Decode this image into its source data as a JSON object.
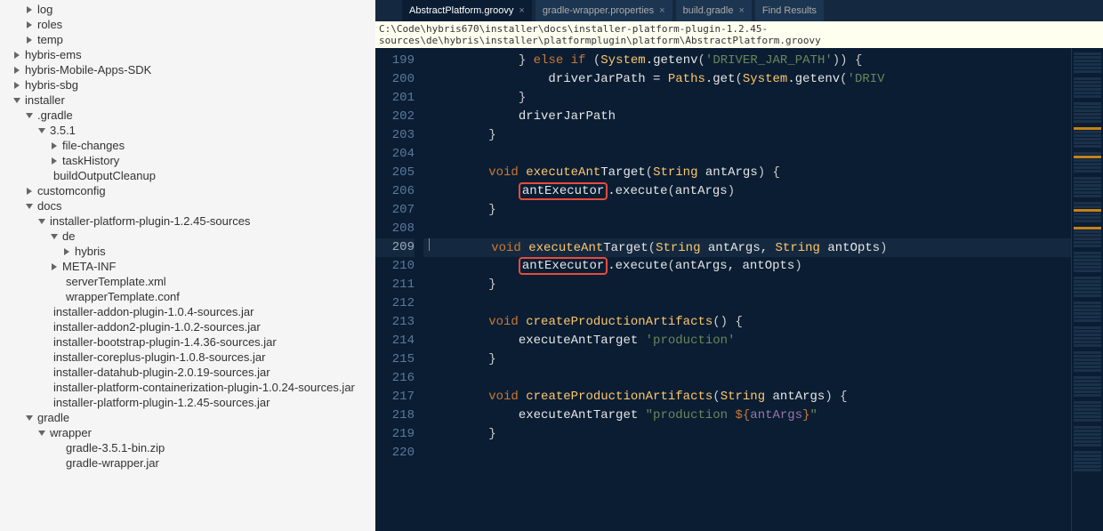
{
  "sidebar": {
    "items": [
      {
        "label": "log",
        "icon": "tri-right",
        "indent": 0
      },
      {
        "label": "roles",
        "icon": "tri-right",
        "indent": 0
      },
      {
        "label": "temp",
        "icon": "tri-right",
        "indent": 0
      },
      {
        "label": "hybris-ems",
        "icon": "tri-right",
        "indent": -1
      },
      {
        "label": "hybris-Mobile-Apps-SDK",
        "icon": "tri-right",
        "indent": -1
      },
      {
        "label": "hybris-sbg",
        "icon": "tri-right",
        "indent": -1
      },
      {
        "label": "installer",
        "icon": "tri-down",
        "indent": -1
      },
      {
        "label": ".gradle",
        "icon": "tri-down",
        "indent": 0
      },
      {
        "label": "3.5.1",
        "icon": "tri-down",
        "indent": 1
      },
      {
        "label": "file-changes",
        "icon": "tri-right",
        "indent": 2
      },
      {
        "label": "taskHistory",
        "icon": "tri-right",
        "indent": 2
      },
      {
        "label": "buildOutputCleanup",
        "icon": "leaf",
        "indent": 1
      },
      {
        "label": "customconfig",
        "icon": "tri-right",
        "indent": 0
      },
      {
        "label": "docs",
        "icon": "tri-down",
        "indent": 0
      },
      {
        "label": "installer-platform-plugin-1.2.45-sources",
        "icon": "tri-down",
        "indent": 1
      },
      {
        "label": "de",
        "icon": "tri-down",
        "indent": 2
      },
      {
        "label": "hybris",
        "icon": "tri-right",
        "indent": 3
      },
      {
        "label": "META-INF",
        "icon": "tri-right",
        "indent": 2
      },
      {
        "label": "serverTemplate.xml",
        "icon": "leaf",
        "indent": 2
      },
      {
        "label": "wrapperTemplate.conf",
        "icon": "leaf",
        "indent": 2
      },
      {
        "label": "installer-addon-plugin-1.0.4-sources.jar",
        "icon": "leaf",
        "indent": 1
      },
      {
        "label": "installer-addon2-plugin-1.0.2-sources.jar",
        "icon": "leaf",
        "indent": 1
      },
      {
        "label": "installer-bootstrap-plugin-1.4.36-sources.jar",
        "icon": "leaf",
        "indent": 1
      },
      {
        "label": "installer-coreplus-plugin-1.0.8-sources.jar",
        "icon": "leaf",
        "indent": 1
      },
      {
        "label": "installer-datahub-plugin-2.0.19-sources.jar",
        "icon": "leaf",
        "indent": 1
      },
      {
        "label": "installer-platform-containerization-plugin-1.0.24-sources.jar",
        "icon": "leaf",
        "indent": 1
      },
      {
        "label": "installer-platform-plugin-1.2.45-sources.jar",
        "icon": "leaf",
        "indent": 1
      },
      {
        "label": "gradle",
        "icon": "tri-down",
        "indent": 0
      },
      {
        "label": "wrapper",
        "icon": "tri-down",
        "indent": 1
      },
      {
        "label": "gradle-3.5.1-bin.zip",
        "icon": "leaf",
        "indent": 2
      },
      {
        "label": "gradle-wrapper.jar",
        "icon": "leaf",
        "indent": 2
      }
    ]
  },
  "tabs": [
    {
      "label": "AbstractPlatform.groovy",
      "active": true
    },
    {
      "label": "gradle-wrapper.properties",
      "active": false
    },
    {
      "label": "build.gradle",
      "active": false
    },
    {
      "label": "Find Results",
      "active": false
    }
  ],
  "filepath": "C:\\Code\\hybris670\\installer\\docs\\installer-platform-plugin-1.2.45-sources\\de\\hybris\\installer\\platformplugin\\platform\\AbstractPlatform.groovy",
  "lineStart": 199,
  "currentLine": 209,
  "code": {
    "lines": [
      {
        "n": 199,
        "t": [
          {
            "c": "w",
            "v": "            "
          },
          {
            "c": "br",
            "v": "}"
          },
          {
            "c": "w",
            "v": " "
          },
          {
            "c": "kw",
            "v": "else if"
          },
          {
            "c": "w",
            "v": " "
          },
          {
            "c": "br",
            "v": "("
          },
          {
            "c": "ty",
            "v": "System"
          },
          {
            "c": "op",
            "v": "."
          },
          {
            "c": "wh",
            "v": "getenv"
          },
          {
            "c": "br",
            "v": "("
          },
          {
            "c": "st",
            "v": "'DRIVER_JAR_PATH'"
          },
          {
            "c": "br",
            "v": "))"
          },
          {
            "c": "w",
            "v": " "
          },
          {
            "c": "br",
            "v": "{"
          }
        ]
      },
      {
        "n": 200,
        "t": [
          {
            "c": "w",
            "v": "                "
          },
          {
            "c": "wh",
            "v": "driverJarPath"
          },
          {
            "c": "w",
            "v": " "
          },
          {
            "c": "op",
            "v": "="
          },
          {
            "c": "w",
            "v": " "
          },
          {
            "c": "ty",
            "v": "Paths"
          },
          {
            "c": "op",
            "v": "."
          },
          {
            "c": "wh",
            "v": "get"
          },
          {
            "c": "br",
            "v": "("
          },
          {
            "c": "ty",
            "v": "System"
          },
          {
            "c": "op",
            "v": "."
          },
          {
            "c": "wh",
            "v": "getenv"
          },
          {
            "c": "br",
            "v": "("
          },
          {
            "c": "st",
            "v": "'DRIV"
          }
        ]
      },
      {
        "n": 201,
        "t": [
          {
            "c": "w",
            "v": "            "
          },
          {
            "c": "br",
            "v": "}"
          }
        ]
      },
      {
        "n": 202,
        "t": [
          {
            "c": "w",
            "v": "            "
          },
          {
            "c": "wh",
            "v": "driverJarPath"
          }
        ]
      },
      {
        "n": 203,
        "t": [
          {
            "c": "w",
            "v": "        "
          },
          {
            "c": "br",
            "v": "}"
          }
        ]
      },
      {
        "n": 204,
        "t": []
      },
      {
        "n": 205,
        "t": [
          {
            "c": "w",
            "v": "        "
          },
          {
            "c": "kw",
            "v": "void"
          },
          {
            "c": "w",
            "v": " "
          },
          {
            "c": "fn",
            "v": "executeAnt"
          },
          {
            "c": "wh",
            "v": "Target"
          },
          {
            "c": "br",
            "v": "("
          },
          {
            "c": "ty",
            "v": "String"
          },
          {
            "c": "w",
            "v": " "
          },
          {
            "c": "wh",
            "v": "antArgs"
          },
          {
            "c": "br",
            "v": ")"
          },
          {
            "c": "w",
            "v": " "
          },
          {
            "c": "br",
            "v": "{"
          }
        ]
      },
      {
        "n": 206,
        "t": [
          {
            "c": "w",
            "v": "            "
          },
          {
            "c": "boxed",
            "v": "antExecutor"
          },
          {
            "c": "op",
            "v": "."
          },
          {
            "c": "wh",
            "v": "execute"
          },
          {
            "c": "br",
            "v": "("
          },
          {
            "c": "wh",
            "v": "antArgs"
          },
          {
            "c": "br",
            "v": ")"
          }
        ]
      },
      {
        "n": 207,
        "t": [
          {
            "c": "w",
            "v": "        "
          },
          {
            "c": "br",
            "v": "}"
          }
        ]
      },
      {
        "n": 208,
        "t": []
      },
      {
        "n": 209,
        "t": [
          {
            "c": "w",
            "v": "        "
          },
          {
            "c": "kw",
            "v": "void"
          },
          {
            "c": "w",
            "v": " "
          },
          {
            "c": "fn",
            "v": "executeAnt"
          },
          {
            "c": "wh",
            "v": "Target"
          },
          {
            "c": "br",
            "v": "("
          },
          {
            "c": "ty",
            "v": "String"
          },
          {
            "c": "w",
            "v": " "
          },
          {
            "c": "wh",
            "v": "antArgs"
          },
          {
            "c": "op",
            "v": ","
          },
          {
            "c": "w",
            "v": " "
          },
          {
            "c": "ty",
            "v": "String"
          },
          {
            "c": "w",
            "v": " "
          },
          {
            "c": "wh",
            "v": "antOpts"
          },
          {
            "c": "br",
            "v": ")"
          }
        ],
        "current": true
      },
      {
        "n": 210,
        "t": [
          {
            "c": "w",
            "v": "            "
          },
          {
            "c": "boxed",
            "v": "antExecutor"
          },
          {
            "c": "op",
            "v": "."
          },
          {
            "c": "wh",
            "v": "execute"
          },
          {
            "c": "br",
            "v": "("
          },
          {
            "c": "wh",
            "v": "antArgs"
          },
          {
            "c": "op",
            "v": ","
          },
          {
            "c": "w",
            "v": " "
          },
          {
            "c": "wh",
            "v": "antOpts"
          },
          {
            "c": "br",
            "v": ")"
          }
        ]
      },
      {
        "n": 211,
        "t": [
          {
            "c": "w",
            "v": "        "
          },
          {
            "c": "br",
            "v": "}"
          }
        ]
      },
      {
        "n": 212,
        "t": []
      },
      {
        "n": 213,
        "t": [
          {
            "c": "w",
            "v": "        "
          },
          {
            "c": "kw",
            "v": "void"
          },
          {
            "c": "w",
            "v": " "
          },
          {
            "c": "fn",
            "v": "createProductionArtifacts"
          },
          {
            "c": "br",
            "v": "()"
          },
          {
            "c": "w",
            "v": " "
          },
          {
            "c": "br",
            "v": "{"
          }
        ]
      },
      {
        "n": 214,
        "t": [
          {
            "c": "w",
            "v": "            "
          },
          {
            "c": "wh",
            "v": "executeAntTarget"
          },
          {
            "c": "w",
            "v": " "
          },
          {
            "c": "st",
            "v": "'production'"
          }
        ]
      },
      {
        "n": 215,
        "t": [
          {
            "c": "w",
            "v": "        "
          },
          {
            "c": "br",
            "v": "}"
          }
        ]
      },
      {
        "n": 216,
        "t": []
      },
      {
        "n": 217,
        "t": [
          {
            "c": "w",
            "v": "        "
          },
          {
            "c": "kw",
            "v": "void"
          },
          {
            "c": "w",
            "v": " "
          },
          {
            "c": "fn",
            "v": "createProductionArtifacts"
          },
          {
            "c": "br",
            "v": "("
          },
          {
            "c": "ty",
            "v": "String"
          },
          {
            "c": "w",
            "v": " "
          },
          {
            "c": "wh",
            "v": "antArgs"
          },
          {
            "c": "br",
            "v": ")"
          },
          {
            "c": "w",
            "v": " "
          },
          {
            "c": "br",
            "v": "{"
          }
        ]
      },
      {
        "n": 218,
        "t": [
          {
            "c": "w",
            "v": "            "
          },
          {
            "c": "wh",
            "v": "executeAntTarget"
          },
          {
            "c": "w",
            "v": " "
          },
          {
            "c": "st",
            "v": "\"production "
          },
          {
            "c": "interp",
            "v": "${"
          },
          {
            "c": "id",
            "v": "antArgs"
          },
          {
            "c": "interp",
            "v": "}"
          },
          {
            "c": "st",
            "v": "\""
          }
        ]
      },
      {
        "n": 219,
        "t": [
          {
            "c": "w",
            "v": "        "
          },
          {
            "c": "br",
            "v": "}"
          }
        ]
      },
      {
        "n": 220,
        "t": []
      }
    ]
  }
}
